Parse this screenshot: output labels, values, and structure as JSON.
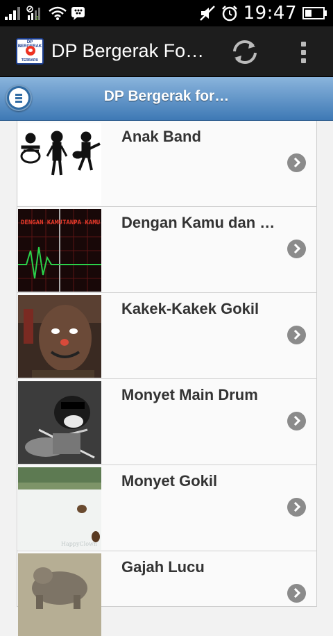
{
  "status_bar": {
    "time": "19:47",
    "icons": [
      "signal-icon",
      "no-sim-icon",
      "wifi-icon",
      "bbm-icon",
      "mute-icon",
      "alarm-icon",
      "battery-icon"
    ]
  },
  "action_bar": {
    "app_icon_top": "DP BERGERAK",
    "app_icon_bottom": "TERBARU",
    "title": "DP Bergerak Fo…",
    "actions": [
      "refresh-icon",
      "overflow-menu-icon"
    ]
  },
  "header": {
    "title": "DP Bergerak for…"
  },
  "items": [
    {
      "label": "Anak Band"
    },
    {
      "label": "Dengan Kamu dan …",
      "thumb_text_left": "DENGAN KAMU",
      "thumb_text_right": "TANPA KAMU"
    },
    {
      "label": "Kakek-Kakek Gokil"
    },
    {
      "label": "Monyet Main Drum"
    },
    {
      "label": "Monyet Gokil"
    },
    {
      "label": "Gajah Lucu"
    }
  ],
  "colors": {
    "header_top": "#8ab4dc",
    "header_bottom": "#3e79b5",
    "actionbar": "#1d1d1d",
    "arrow": "#8b8b8b"
  }
}
